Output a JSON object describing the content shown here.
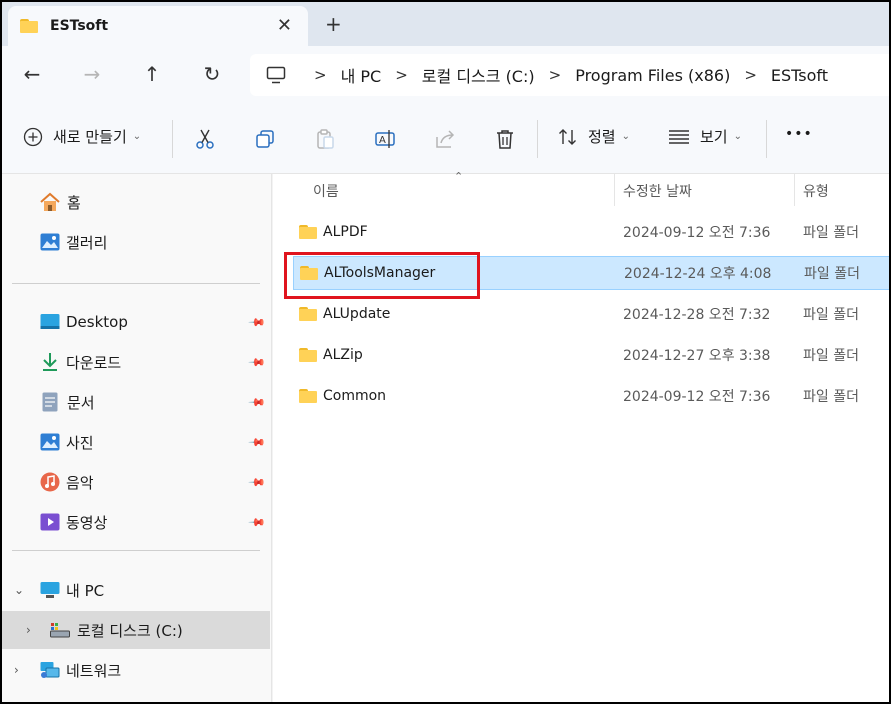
{
  "tab": {
    "title": "ESTsoft",
    "close": "✕",
    "new": "+"
  },
  "nav": {
    "back": "←",
    "forward": "→",
    "up": "↑",
    "refresh": "↻"
  },
  "breadcrumbs": [
    "내 PC",
    "로컬 디스크 (C:)",
    "Program Files (x86)",
    "ESTsoft"
  ],
  "breadcrumb_separator": ">",
  "commands": {
    "new_label": "새로 만들기",
    "sort_label": "정렬",
    "view_label": "보기",
    "more": "•••",
    "chevron": "⌄"
  },
  "sidebar": {
    "quick": [
      {
        "label": "홈",
        "icon": "home-icon"
      },
      {
        "label": "갤러리",
        "icon": "gallery-icon"
      }
    ],
    "pinned": [
      {
        "label": "Desktop",
        "icon": "desktop-icon"
      },
      {
        "label": "다운로드",
        "icon": "download-icon"
      },
      {
        "label": "문서",
        "icon": "document-icon"
      },
      {
        "label": "사진",
        "icon": "pictures-icon"
      },
      {
        "label": "음악",
        "icon": "music-icon"
      },
      {
        "label": "동영상",
        "icon": "video-icon"
      }
    ],
    "tree": [
      {
        "label": "내 PC",
        "icon": "pc-icon",
        "expand": "⌄"
      },
      {
        "label": "로컬 디스크 (C:)",
        "icon": "drive-icon",
        "expand": "›"
      },
      {
        "label": "네트워크",
        "icon": "network-icon",
        "expand": "›"
      }
    ]
  },
  "columns": {
    "name": "이름",
    "date": "수정한 날짜",
    "type": "유형"
  },
  "files": [
    {
      "name": "ALPDF",
      "date": "2024-09-12 오전 7:36",
      "type": "파일 폴더"
    },
    {
      "name": "ALToolsManager",
      "date": "2024-12-24 오후 4:08",
      "type": "파일 폴더"
    },
    {
      "name": "ALUpdate",
      "date": "2024-12-28 오전 7:32",
      "type": "파일 폴더"
    },
    {
      "name": "ALZip",
      "date": "2024-12-27 오후 3:38",
      "type": "파일 폴더"
    },
    {
      "name": "Common",
      "date": "2024-09-12 오전 7:36",
      "type": "파일 폴더"
    }
  ],
  "colors": {
    "selection": "#cce8ff",
    "highlight": "#e0141e",
    "folder": "#ffd257"
  }
}
